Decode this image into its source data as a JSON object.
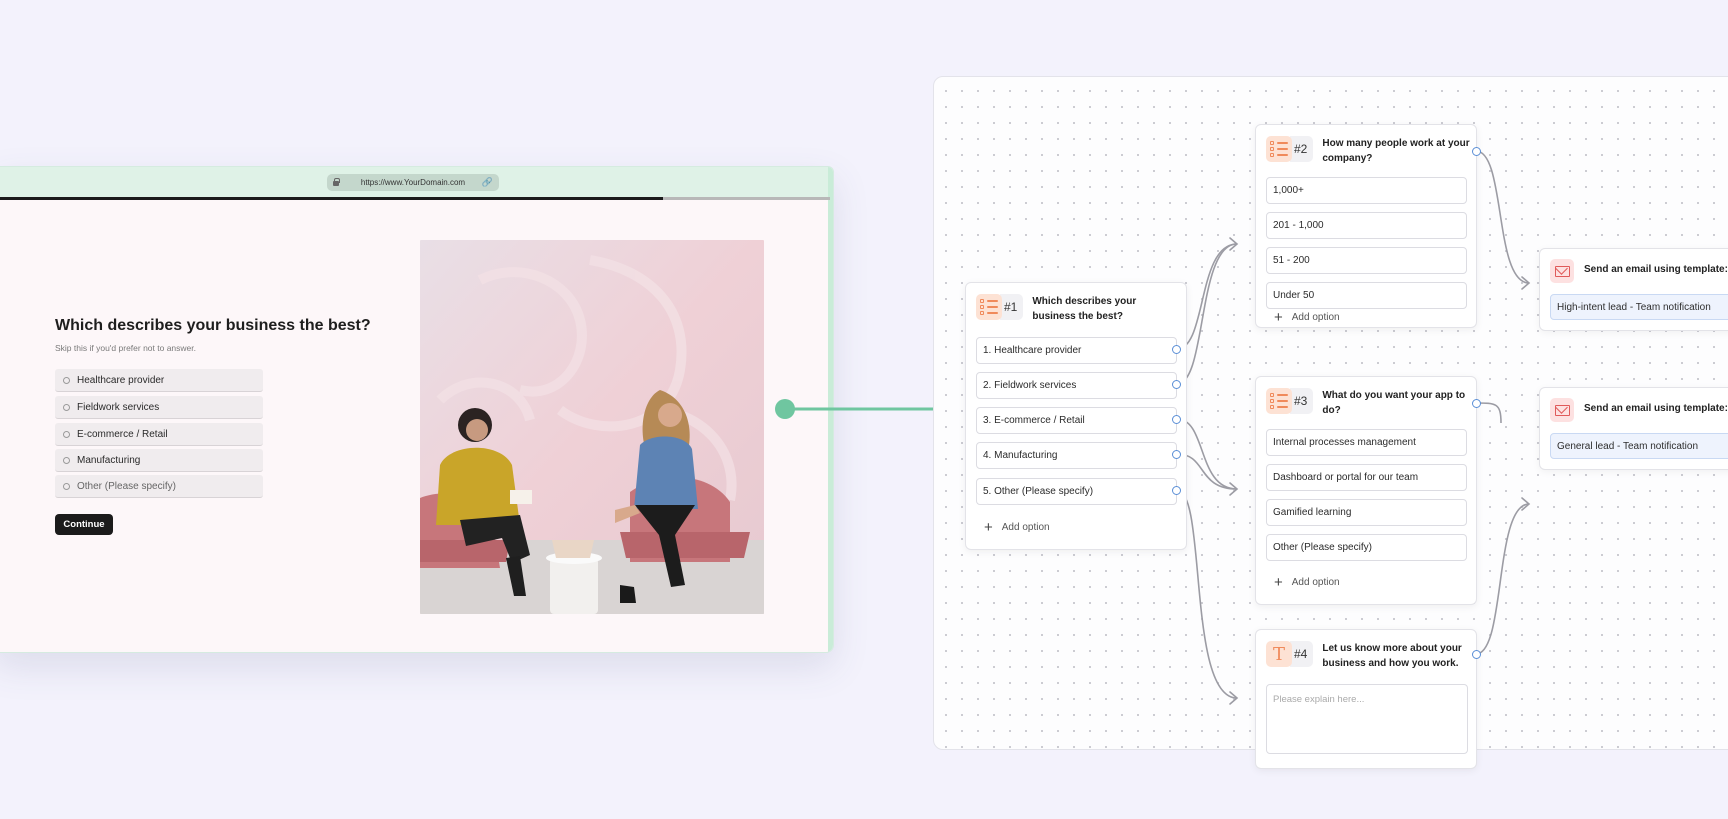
{
  "browser": {
    "url": "https://www.YourDomain.com",
    "progress_percent": 80
  },
  "form": {
    "question": "Which describes your business the best?",
    "subtitle": "Skip this if you'd prefer not to answer.",
    "options": [
      "Healthcare provider",
      "Fieldwork services",
      "E-commerce / Retail",
      "Manufacturing",
      "Other (Please specify)"
    ],
    "continue_label": "Continue"
  },
  "flow": {
    "q1": {
      "number": "#1",
      "title": "Which describes your business the best?",
      "options": [
        "1. Healthcare provider",
        "2. Fieldwork services",
        "3. E-commerce / Retail",
        "4. Manufacturing",
        "5. Other (Please specify)"
      ],
      "add_option": "Add option"
    },
    "q2": {
      "number": "#2",
      "title": "How many people work at your company?",
      "options": [
        "1,000+",
        "201 - 1,000",
        "51 - 200",
        "Under 50"
      ],
      "add_option": "Add option"
    },
    "q3": {
      "number": "#3",
      "title": "What do you want your app to do?",
      "options": [
        "Internal processes management",
        "Dashboard or portal for our team",
        "Gamified learning",
        "Other (Please specify)"
      ],
      "add_option": "Add option"
    },
    "q4": {
      "number": "#4",
      "title": "Let us know more about your business and how you work.",
      "placeholder": "Please explain here..."
    },
    "emails": [
      {
        "title": "Send an email using template:",
        "template": "High-intent lead - Team notification"
      },
      {
        "title": "Send an email using template:",
        "template": "General lead - Team notification"
      }
    ]
  },
  "colors": {
    "accent_green": "#6fc6a0",
    "port_blue": "#5b8fd6",
    "question_icon": "#f08a5b",
    "email_icon": "#e05a5a"
  },
  "icons": {
    "lock": "lock-icon",
    "link": "link-icon",
    "question": "list-checklist-icon",
    "text_question": "text-icon",
    "email": "mail-icon",
    "add": "plus-icon"
  }
}
